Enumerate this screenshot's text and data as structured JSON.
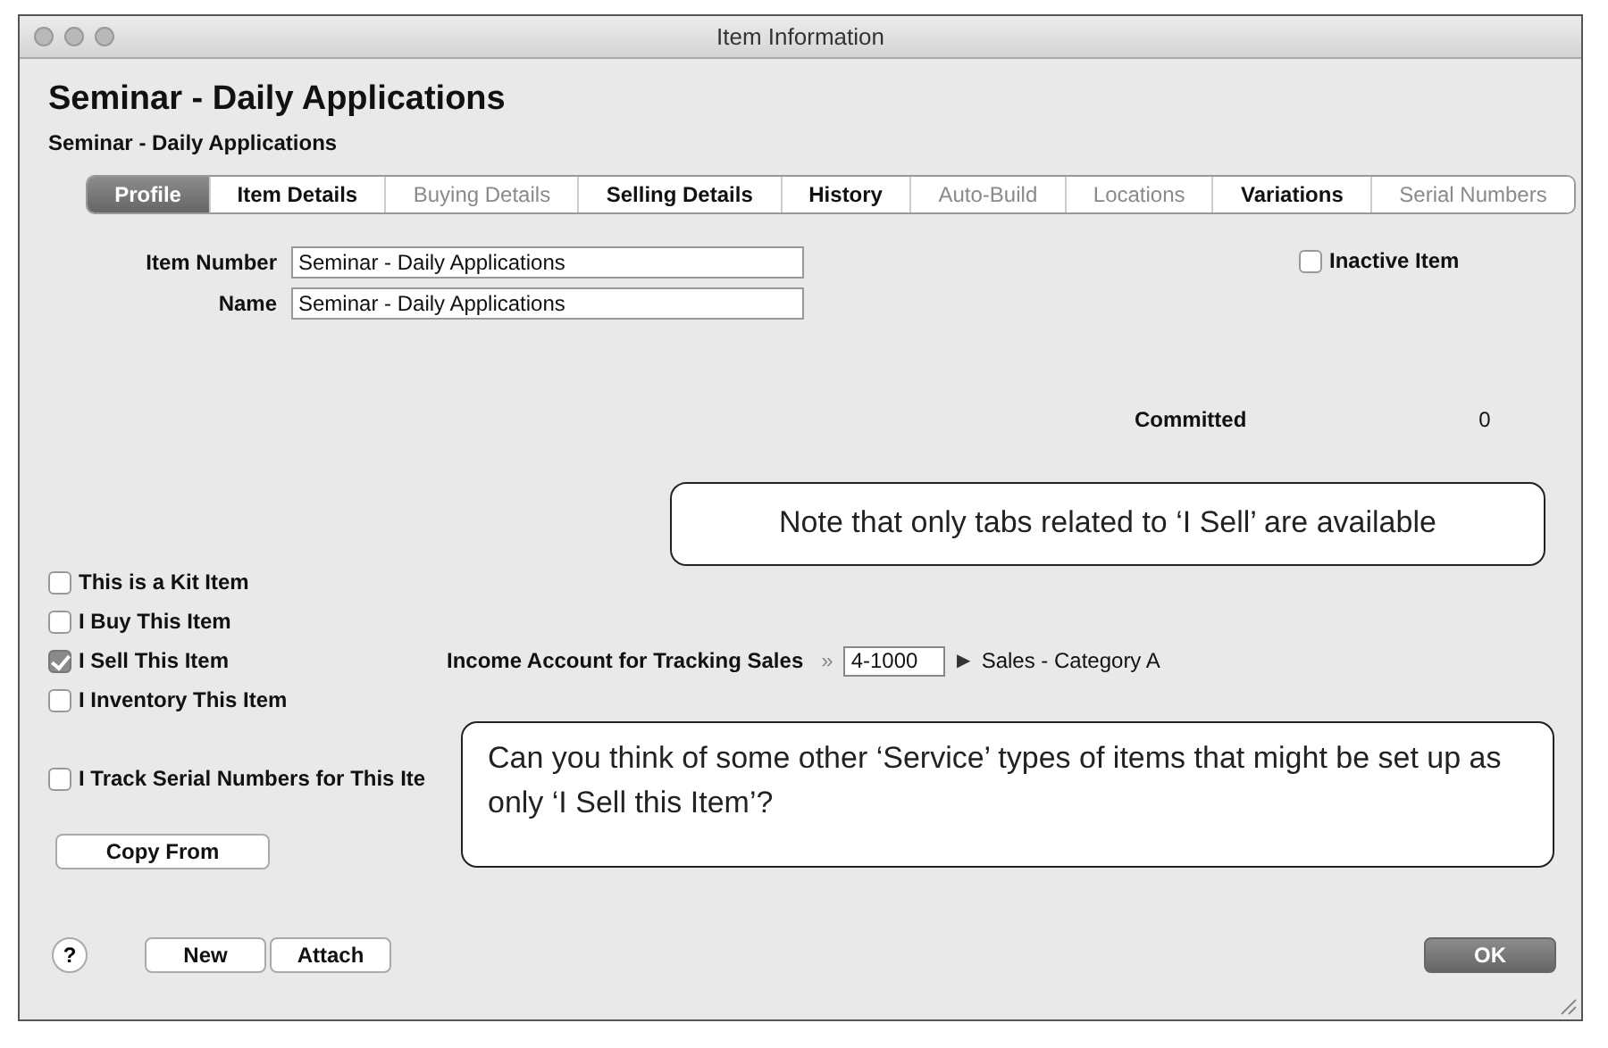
{
  "window": {
    "title": "Item Information"
  },
  "header": {
    "title": "Seminar - Daily Applications",
    "subtitle": "Seminar - Daily Applications"
  },
  "tabs": [
    {
      "label": "Profile",
      "selected": true,
      "disabled": false
    },
    {
      "label": "Item Details",
      "selected": false,
      "disabled": false
    },
    {
      "label": "Buying Details",
      "selected": false,
      "disabled": true
    },
    {
      "label": "Selling Details",
      "selected": false,
      "disabled": false
    },
    {
      "label": "History",
      "selected": false,
      "disabled": false
    },
    {
      "label": "Auto-Build",
      "selected": false,
      "disabled": true
    },
    {
      "label": "Locations",
      "selected": false,
      "disabled": true
    },
    {
      "label": "Variations",
      "selected": false,
      "disabled": false
    },
    {
      "label": "Serial Numbers",
      "selected": false,
      "disabled": true
    }
  ],
  "fields": [
    {
      "label": "Item Number",
      "value": "Seminar - Daily Applications"
    },
    {
      "label": "Name",
      "value": "Seminar - Daily Applications"
    }
  ],
  "inactive": {
    "label": "Inactive Item",
    "checked": false
  },
  "committed": {
    "label": "Committed",
    "value": "0"
  },
  "options": [
    {
      "label": "This is a Kit Item",
      "checked": false
    },
    {
      "label": "I Buy This Item",
      "checked": false
    },
    {
      "label": "I Sell This Item",
      "checked": true
    },
    {
      "label": "I Inventory This Item",
      "checked": false
    }
  ],
  "income_account": {
    "label": "Income Account for Tracking Sales",
    "arrow": "»",
    "account": "4-1000",
    "link": "▶",
    "name": "Sales - Category A"
  },
  "serial_option": {
    "label": "I Track Serial Numbers for This Ite",
    "checked": false
  },
  "buttons": {
    "copy": "Copy From",
    "help": "?",
    "new": "New",
    "attach": "Attach",
    "ok": "OK"
  },
  "callouts": [
    "Note that only tabs related to ‘I Sell’ are available",
    "Can you think of some other ‘Service’ types of items that might be set up as only ‘I Sell this Item’?"
  ]
}
